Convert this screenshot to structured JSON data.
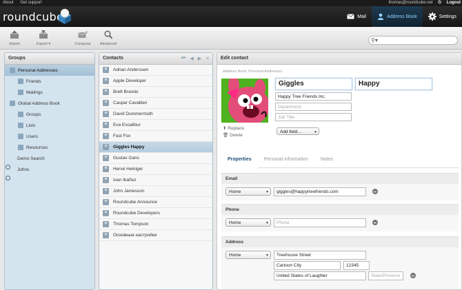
{
  "topbar": {
    "about": "About",
    "support": "Get support",
    "user": "thomas@roundcube.net",
    "logout": "Logout"
  },
  "header": {
    "logo": "roundcube",
    "nav": [
      {
        "label": "Mail",
        "icon": "mail-icon"
      },
      {
        "label": "Address Book",
        "icon": "address-book-icon"
      },
      {
        "label": "Settings",
        "icon": "gear-icon"
      }
    ]
  },
  "toolbar": {
    "import": "Import",
    "export": "Export",
    "compose": "Compose",
    "advanced": "Advanced",
    "search_placeholder": ""
  },
  "groups": {
    "title": "Groups",
    "items": [
      {
        "label": "Personal Addresses",
        "level": 0,
        "selected": true
      },
      {
        "label": "Friends",
        "level": 1
      },
      {
        "label": "Mailings",
        "level": 1
      },
      {
        "label": "Global Address Book",
        "level": 0
      },
      {
        "label": "Groups",
        "level": 1
      },
      {
        "label": "Lists",
        "level": 1
      },
      {
        "label": "Users",
        "level": 1
      },
      {
        "label": "Resources",
        "level": 1
      },
      {
        "label": "Demo Search",
        "level": 0,
        "search": true
      },
      {
        "label": "Johns",
        "level": 0,
        "search": true
      }
    ]
  },
  "contacts": {
    "title": "Contacts",
    "items": [
      "Adrian Anderssen",
      "Apple Developer",
      "Brett Brando",
      "Caspar Cavallieri",
      "David Dummermuth",
      "Eva Escalibur",
      "Fast Fox",
      "Giggles Happy",
      "Gustav Gans",
      "Hervé Heiniger",
      "Ivan Ibañez",
      "John Jamesson",
      "Roundcube Announce",
      "Roundcube Developers",
      "Thomas Tompson",
      "Основные настройки"
    ],
    "selected_index": 7
  },
  "edit": {
    "title": "Edit contact",
    "address_book": "Address Book: Personal Addresses",
    "first_name": "Giggles",
    "last_name": "Happy",
    "organization": "Happy Tree Friends Inc.",
    "department_placeholder": "Department",
    "job_title_placeholder": "Job Title",
    "replace": "Replace",
    "delete": "Delete",
    "add_field": "Add field...",
    "tabs": [
      "Properties",
      "Personal information",
      "Notes"
    ],
    "email": {
      "title": "Email",
      "type": "Home",
      "value": "giggles@happytreefriends.com"
    },
    "phone": {
      "title": "Phone",
      "type": "Home",
      "placeholder": "Phone"
    },
    "address": {
      "title": "Address",
      "type": "Home",
      "street": "Treehouse Street",
      "city": "Cartoon City",
      "zip": "12345",
      "country": "United States of Laughter",
      "state_placeholder": "State/Province"
    }
  },
  "colors": {
    "accent": "#8fd0ff",
    "selection": "#b5cde0",
    "panel_bg": "#d4e4ee"
  }
}
